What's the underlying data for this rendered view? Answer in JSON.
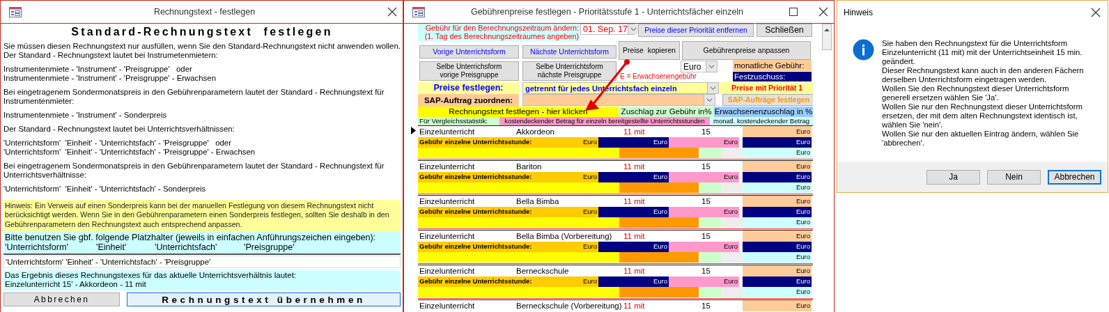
{
  "invoice_text_window": {
    "title": "Rechnungstext - festlegen",
    "heading": "Standard-Rechnungstext festlegen",
    "paragraphs": [
      {
        "lines": [
          "Sie müssen diesen Rechnungstext nur ausfüllen, wenn Sie den Standard-Rechnungstext nicht anwenden wollen.",
          "Der Standard - Rechnungstext lautet bei Instrumetenmietern:"
        ]
      },
      {
        "lines": [
          "Instrumentenmiete - 'Instrument' - 'Preisgruppe'   oder",
          "Instrumentenmiete - 'Instrument' - 'Preisgruppe' - Erwachsen"
        ]
      },
      {
        "lines": [
          "Bei eingetragenem Sondermonatspreis in den Gebührenparametern lautet der Standard - Rechnungstext für",
          "Instrumentenmieter:"
        ]
      },
      {
        "lines": [
          "Instrumentenmiete - 'Instrument' - Sonderpreis"
        ]
      },
      {
        "lines": [
          "Der Standard - Rechnungstext lautet bei Unterrichtsverhältnissen:"
        ]
      },
      {
        "lines": [
          "'Unterrichtsform'  'Einheit' - 'Unterrichtsfach' - 'Preisgruppe'   oder",
          "'Unterrichtsform'  'Einheit' - 'Unterrichtsfach' - 'Preisgruppe' - Erwachsen"
        ]
      },
      {
        "lines": [
          "Bei eingetragenem Sondermonatspreis in den Gebührenparametern lautet der Standard - Rechnungstext für",
          "Unterrichtsverhältnisse:"
        ]
      },
      {
        "lines": [
          "'Unterrichtsform'  'Einheit' - 'Unterrichtsfach' - Sonderpreis"
        ]
      }
    ],
    "hint_lines": [
      "Hinweis: Ein Verweis auf einen Sonderpreis kann bei der manuellen Festlegung von diesem Rechnungstext nicht",
      "berücksichtigt werden. Wenn Sie in den Gebührenparametern einen Sonderpreis festlegen, sollten Sie deshalb in den",
      "Gebührenparametern den Rechnungstext auch entsprechend anpassen."
    ],
    "placeholder_intro": "Bitte benutzen Sie gbf. folgende Platzhalter (jeweils in einfachen Anführungszeichen eingeben):",
    "placeholders": [
      "'Unterrichtsform'",
      "'Einheit'",
      "'Unterrichtsfach'",
      "'Preisgruppe'"
    ],
    "invoice_text_value": "'Unterrichtsform' 'Einheit' - 'Unterrichtsfach' - 'Preisgruppe'",
    "result_lines": [
      "Das Ergebnis dieses Rechnungstexes für das aktuelle Unterrichtsverhältnis lautet:",
      "Einzelunterricht 15' - Akkordeon - 11 mit"
    ],
    "buttons": [
      {
        "label": "Abbrechen",
        "kind": "cancel"
      },
      {
        "label": "Rechnungstext übernehmen",
        "kind": "primary"
      }
    ]
  },
  "price_window": {
    "title": "Gebührenpreise festlegen - Prioritätsstufe 1 - Unterrichtsfächer einzeln",
    "period_label_lines": [
      "Gebühr für den Berechnungszeitraum ändern:",
      "(1. Tag des Berechnungszeitraumes angeben)"
    ],
    "period_date": "01. Sep. 17",
    "remove_button": "Preise dieser Priorität entfernen",
    "close_button": "Schließen",
    "copy_button": "Preise  kopieren",
    "adjust_button": "Gebührenpreise anpassen",
    "nav_buttons": [
      "Vorige Unterrichtsform",
      "Nächste Unterrichtsform"
    ],
    "group_buttons": [
      {
        "lines": [
          "Selbe Unterrichsform",
          "vorige Preisgruppe"
        ]
      },
      {
        "lines": [
          "Selbe Unterrichtsform",
          "nächste Preisgruppe"
        ]
      }
    ],
    "currency": "Euro",
    "adult_note": "E = Erwachsenengebühr",
    "monthly_fee_label": "monatliche Gebühr:",
    "fixed_subsidy_label": "Festzuschuss:",
    "pricing_label": "Preise festlegen:",
    "pricing_mode": "getrennt für jedes Unterrichtsfach einzeln",
    "priority_label": "Preise mit Priorität 1",
    "sap_label": "SAP-Auftrag zuordnen:",
    "sap_button": "SAP-Aufträge festlegen",
    "invoice_text_link": "Rechnungstext festlegen - hier klicken",
    "surcharge_header": "Zuschlag zur Gebühr in%",
    "adult_surcharge_header": "Erwachsenenzuschlag in %",
    "stats_label": "Für Vergleichsstatistik:",
    "cost_header": "kostendeckender Betrag für einzeln bereitgestellte Unterrichtsstunden",
    "monthly_cost_header": "monatl. kostendeckender Betrag",
    "rows": [
      {
        "selected": true,
        "form": "Einzelunterricht",
        "subject": "Akkordeon",
        "column_3": "11 mit",
        "unit": "15",
        "fee_label": "Gebühr einzelne Unterrichtsstunde:",
        "currency_cells": [
          "Euro",
          "Euro",
          "Euro",
          "Euro",
          "Euro",
          "Euro"
        ]
      },
      {
        "selected": false,
        "form": "Einzelunterricht",
        "subject": "Bariton",
        "column_3": "11 mit",
        "unit": "15",
        "fee_label": "Gebühr einzelne Unterrichtsstunde:",
        "currency_cells": [
          "Euro",
          "Euro",
          "Euro",
          "Euro",
          "Euro",
          "Euro"
        ]
      },
      {
        "selected": false,
        "form": "Einzelunterricht",
        "subject": "Bella Bimba",
        "column_3": "11 mit",
        "unit": "15",
        "fee_label": "Gebühr einzelne Unterrichtsstunde:",
        "currency_cells": [
          "Euro",
          "Euro",
          "Euro",
          "Euro",
          "Euro",
          "Euro"
        ]
      },
      {
        "selected": false,
        "form": "Einzelunterricht",
        "subject": "Bella Bimba (Vorbereitung)",
        "column_3": "11 mit",
        "unit": "15",
        "fee_label": "Gebühr einzelne Unterrichtsstunde:",
        "currency_cells": [
          "Euro",
          "Euro",
          "Euro",
          "Euro",
          "Euro",
          "Euro"
        ]
      },
      {
        "selected": false,
        "form": "Einzelunterricht",
        "subject": "Berneckschule",
        "column_3": "11 mit",
        "unit": "15",
        "fee_label": "Gebühr einzelne Unterrichtsstunde:",
        "currency_cells": [
          "Euro",
          "Euro",
          "Euro",
          "Euro",
          "Euro",
          "Euro"
        ]
      },
      {
        "selected": false,
        "form": "Einzelunterricht",
        "subject": "Berneckschule (Vorbereitung)",
        "column_3": "11 mit",
        "unit": "15",
        "currency_cells": [
          "Euro"
        ]
      }
    ]
  },
  "dialog": {
    "title": "Hinweis",
    "message_lines": [
      "Sie haben den Rechnungstext für die Unterrichtsform",
      "Einzelunterricht (11 mit) mit der Unterrichtseinheit 15 min.",
      "geändert.",
      "Dieser Rechnungstext kann auch in den anderen Fächern",
      "derselben Unterrichtsform eingetragen werden.",
      "Wollen Sie den Rechnungstext dieser Unterrichtsform",
      "generell ersetzen wählen Sie 'Ja'.",
      "Wollen Sie nur den Rechnungstext dieser Unterrichtsform",
      "ersetzen, der mit dem alten Rechnungstext identisch ist,",
      "wählen Sie 'nein'.",
      "Wollen Sie nur den aktuellen Eintrag ändern, wählen Sie",
      "'abbrechen'."
    ],
    "buttons": [
      {
        "label": "Ja",
        "default": false
      },
      {
        "label": "Nein",
        "default": false
      },
      {
        "label": "Abbrechen",
        "default": true
      }
    ]
  }
}
